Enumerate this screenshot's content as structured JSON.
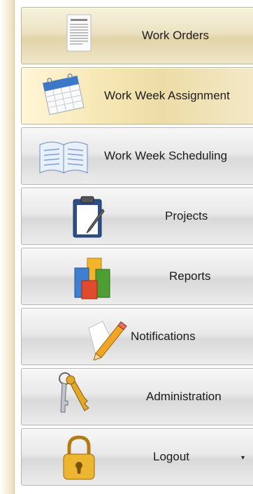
{
  "menu": {
    "items": [
      {
        "id": "work-orders",
        "label": "Work Orders"
      },
      {
        "id": "work-week-assignment",
        "label": "Work Week Assignment"
      },
      {
        "id": "work-week-scheduling",
        "label": "Work Week Scheduling"
      },
      {
        "id": "projects",
        "label": "Projects"
      },
      {
        "id": "reports",
        "label": "Reports"
      },
      {
        "id": "notifications",
        "label": "Notifications"
      },
      {
        "id": "administration",
        "label": "Administration"
      },
      {
        "id": "logout",
        "label": "Logout",
        "arrow": "▾"
      }
    ],
    "icons": [
      "document-icon",
      "calendar-icon",
      "book-icon",
      "clipboard-icon",
      "bar-chart-icon",
      "pencil-note-icon",
      "keys-icon",
      "padlock-icon"
    ],
    "active_item": "Work Week Assignment"
  },
  "colors": {
    "tan_item": "#ece2c2",
    "grey_item": "#e9e9e9"
  }
}
